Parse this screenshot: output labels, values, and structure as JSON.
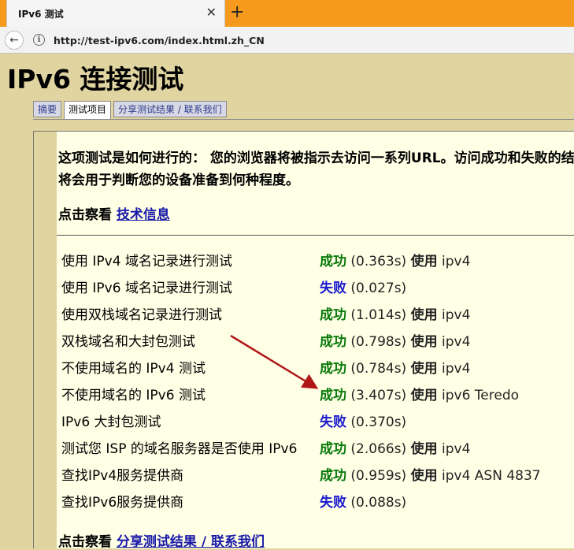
{
  "browser": {
    "tab_title": "IPv6 测试",
    "close_glyph": "✕",
    "new_tab_glyph": "+",
    "back_glyph": "←",
    "info_glyph": "i",
    "url": "http://test-ipv6.com/index.html.zh_CN"
  },
  "page": {
    "title": "IPv6 连接测试",
    "tabs": [
      "摘要",
      "测试项目",
      "分享测试结果 / 联系我们"
    ],
    "intro": "这项测试是如何进行的： 您的浏览器将被指示去访问一系列URL。访问成功和失败的结果将会用于判断您的设备准备到何种程度。",
    "tech_prefix": "点击察看 ",
    "tech_link": "技术信息",
    "footer_prefix": "点击察看 ",
    "footer_link": "分享测试结果 / 联系我们"
  },
  "results": [
    {
      "name": "使用 IPv4 域名记录进行测试",
      "status": "成功",
      "time": " (0.363s) ",
      "using": "使用",
      "detail": " ipv4"
    },
    {
      "name": "使用 IPv6 域名记录进行测试",
      "status": "失败",
      "time": " (0.027s)",
      "using": "",
      "detail": ""
    },
    {
      "name": "使用双栈域名记录进行测试",
      "status": "成功",
      "time": " (1.014s) ",
      "using": "使用",
      "detail": " ipv4"
    },
    {
      "name": "双栈域名和大封包测试",
      "status": "成功",
      "time": " (0.798s) ",
      "using": "使用",
      "detail": " ipv4"
    },
    {
      "name": "不使用域名的 IPv4 测试",
      "status": "成功",
      "time": " (0.784s) ",
      "using": "使用",
      "detail": " ipv4"
    },
    {
      "name": "不使用域名的 IPv6 测试",
      "status": "成功",
      "time": " (3.407s) ",
      "using": "使用",
      "detail": " ipv6 Teredo"
    },
    {
      "name": "IPv6 大封包测试",
      "status": "失败",
      "time": " (0.370s)",
      "using": "",
      "detail": ""
    },
    {
      "name": "测试您 ISP 的域名服务器是否使用 IPv6",
      "status": "成功",
      "time": " (2.066s) ",
      "using": "使用",
      "detail": " ipv4"
    },
    {
      "name": "查找IPv4服务提供商",
      "status": "成功",
      "time": " (0.959s) ",
      "using": "使用",
      "detail": " ipv4 ASN 4837"
    },
    {
      "name": "查找IPv6服务提供商",
      "status": "失败",
      "time": " (0.088s)",
      "using": "",
      "detail": ""
    }
  ],
  "colors": {
    "success": "#0a7a0a",
    "fail": "#1a1ad0",
    "arrow": "#b01818",
    "link": "#1a1aa8",
    "tab_bar": "#f59a1d",
    "page_bg": "#e0d4a0"
  },
  "icons": {
    "back": "back-arrow-icon",
    "info": "info-icon",
    "close": "close-icon",
    "new_tab": "plus-icon",
    "annotation": "red-arrow-annotation"
  }
}
